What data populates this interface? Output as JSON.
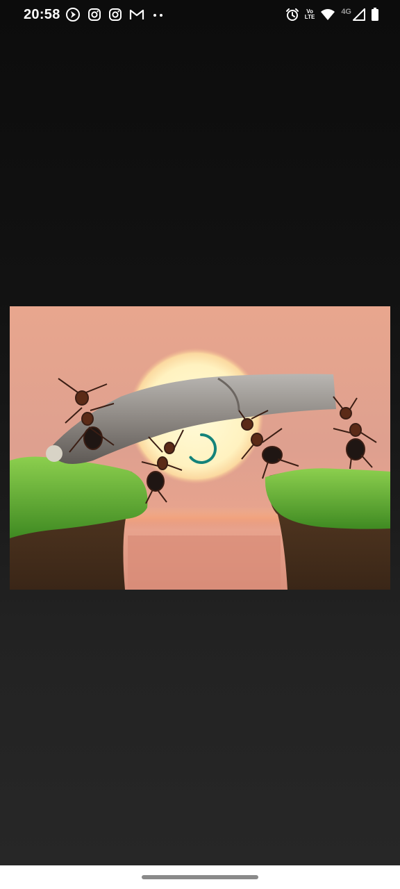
{
  "status_bar": {
    "time": "20:58",
    "left_icons": [
      "navigation-arrow-icon",
      "instagram-icon",
      "instagram-icon",
      "gmail-icon",
      "more-dots-icon"
    ],
    "right_icons": [
      "alarm-icon",
      "volte-icon",
      "wifi-icon",
      "signal-icon",
      "battery-icon"
    ],
    "network_type": "4G",
    "volte_top": "Vo",
    "volte_bottom": "LTE"
  },
  "viewer": {
    "image_subject": "ants-carrying-branch-bridge-sunset-image",
    "loading": true,
    "accent_color": "#14837a"
  },
  "colors": {
    "background": "#121212",
    "nav_bar": "#ffffff",
    "home_indicator": "#8a8a8a"
  }
}
